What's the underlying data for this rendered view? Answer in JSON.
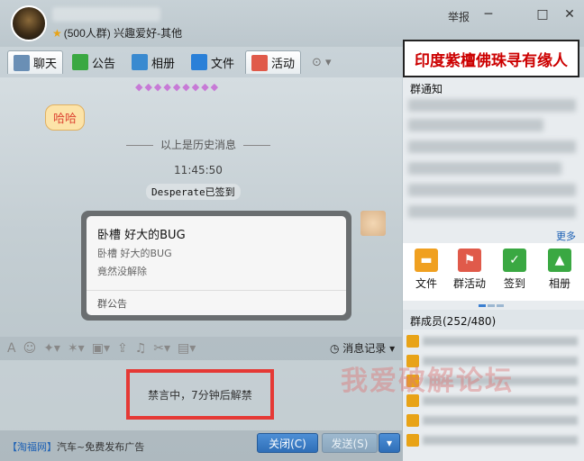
{
  "window": {
    "group_title": "(500人群) 兴趣爱好-其他",
    "report_label": "举报",
    "minimize": "─",
    "maximize": "□",
    "close": "✕"
  },
  "tabs": [
    {
      "label": "聊天",
      "icon": "chat-icon"
    },
    {
      "label": "公告",
      "icon": "flag-icon"
    },
    {
      "label": "相册",
      "icon": "photo-icon"
    },
    {
      "label": "文件",
      "icon": "folder-icon"
    },
    {
      "label": "活动",
      "icon": "activity-flag-icon"
    }
  ],
  "banner": "印度紫檀佛珠寻有缘人",
  "chat": {
    "haha_bubble": "哈哈",
    "history_divider": "以上是历史消息",
    "timestamp": "11:45:50",
    "signin_notice": "Desperate已签到"
  },
  "popup": {
    "title": "卧槽 好大的BUG",
    "line1": "卧槽 好大的BUG",
    "line2": "竟然没解除",
    "footer": "群公告"
  },
  "toolbar": {
    "message_log": "消息记录"
  },
  "input": {
    "mute_text": "禁言中，7分钟后解禁"
  },
  "status": {
    "ad_brand": "【淘福网】",
    "ad_text": "汽车~免费发布广告",
    "close_button": "关闭(C)",
    "send_button": "发送(S)",
    "send_dropdown": "▾"
  },
  "right_panel": {
    "notice_header": "群通知",
    "more_link": "更多",
    "apps": [
      {
        "label": "文件",
        "icon": "folder-icon",
        "color": "#f0a020"
      },
      {
        "label": "群活动",
        "icon": "activity-flag-icon",
        "color": "#e05a4a"
      },
      {
        "label": "签到",
        "icon": "checkin-icon",
        "color": "#3aa842"
      },
      {
        "label": "相册",
        "icon": "photo-icon",
        "color": "#3aa842"
      }
    ],
    "members_header": "群成员(252/480)"
  },
  "watermark": "我爱破解论坛"
}
